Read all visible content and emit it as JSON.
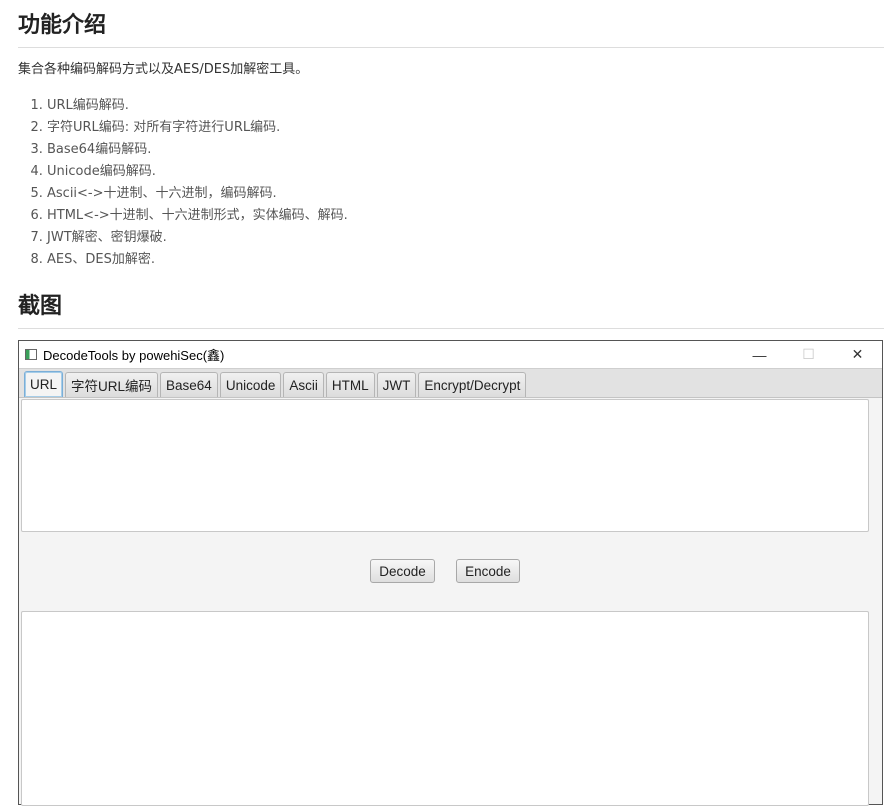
{
  "doc": {
    "heading_features": "功能介绍",
    "intro": "集合各种编码解码方式以及AES/DES加解密工具。",
    "features": [
      "URL编码解码.",
      "字符URL编码: 对所有字符进行URL编码.",
      "Base64编码解码.",
      "Unicode编码解码.",
      "Ascii<->十进制、十六进制，编码解码.",
      "HTML<->十进制、十六进制形式，实体编码、解码.",
      "JWT解密、密钥爆破.",
      "AES、DES加解密."
    ],
    "heading_screenshot": "截图"
  },
  "window": {
    "title": "DecodeTools by powehiSec(鑫)",
    "controls": {
      "minimize": "—",
      "maximize": "☐",
      "close": "✕"
    },
    "tabs": [
      {
        "label": "URL",
        "active": true
      },
      {
        "label": "字符URL编码",
        "active": false
      },
      {
        "label": "Base64",
        "active": false
      },
      {
        "label": "Unicode",
        "active": false
      },
      {
        "label": "Ascii",
        "active": false
      },
      {
        "label": "HTML",
        "active": false
      },
      {
        "label": "JWT",
        "active": false
      },
      {
        "label": "Encrypt/Decrypt",
        "active": false
      }
    ],
    "input_text": "",
    "output_text": "",
    "buttons": {
      "decode": "Decode",
      "encode": "Encode"
    }
  },
  "colors": {
    "active_tab_border": "#7aaed8",
    "window_background": "#f4f4f4"
  }
}
